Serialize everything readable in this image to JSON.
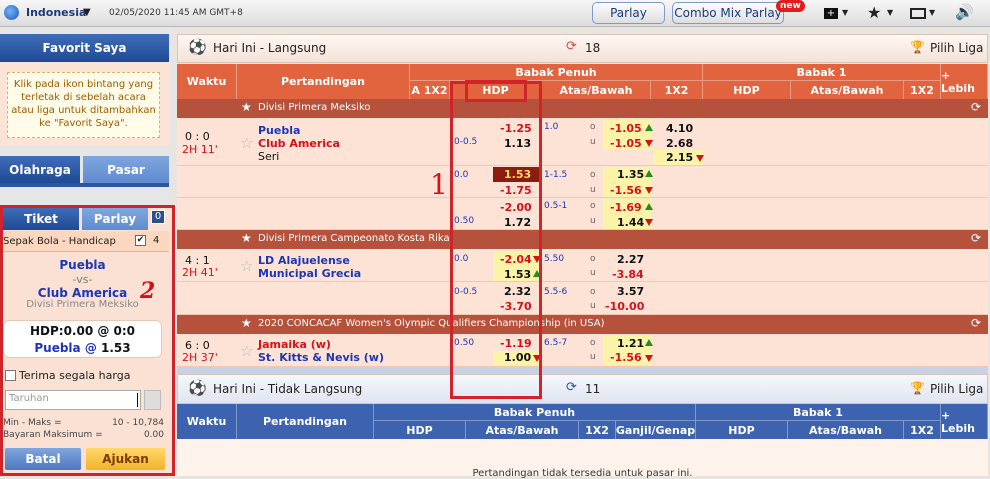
{
  "topbar": {
    "country": "Indonesia",
    "datetime": "02/05/2020 11:45 AM GMT+8",
    "parlay": "Parlay",
    "combo": "Combo Mix Parlay",
    "new_badge": "new"
  },
  "sidebar": {
    "fav_title": "Favorit Saya",
    "fav_hint": "Klik pada ikon bintang yang terletak di sebelah acara atau liga untuk ditambahkan ke \"Favorit Saya\".",
    "tab_olahraga": "Olahraga",
    "tab_pasar": "Pasar",
    "tab_tiket": "Tiket",
    "tab_parlay": "Parlay",
    "parlay_count": "0",
    "bet_type": "Sepak Bola - Handicap",
    "bet_count": "4",
    "home": "Puebla",
    "vs": "-vs-",
    "away": "Club America",
    "league": "Divisi Primera Meksiko",
    "hdp_line": "HDP:0.00 @ 0:0",
    "pick_team": "Puebla",
    "pick_at": "@",
    "pick_odds": "1.53",
    "accept_label": "Terima segala harga",
    "stake_placeholder": "Taruhan",
    "minmax_label": "Min - Maks =",
    "minmax_value": "10 - 10,784",
    "maxpay_label": "Bayaran Maksimum =",
    "maxpay_value": "0.00",
    "cancel": "Batal",
    "submit": "Ajukan",
    "annot2": "2"
  },
  "live": {
    "title": "Hari Ini - Langsung",
    "count": "18",
    "pick_league": "Pilih Liga",
    "col_waktu": "Waktu",
    "col_match": "Pertandingan",
    "babak_penuh": "Babak Penuh",
    "babak1": "Babak 1",
    "lebih": "+ Lebih",
    "a1x2": "A 1X2",
    "hdp": "HDP",
    "atasbawah": "Atas/Bawah",
    "x12": "1X2",
    "hdp2": "HDP",
    "atasbawah2": "Atas/Bawah",
    "x12b": "1X2"
  },
  "annot1": "1",
  "leagues": [
    {
      "name": "Divisi Primera Meksiko",
      "score": "0 : 0",
      "time": "2H 11'",
      "home": "Puebla",
      "away": "Club America",
      "draw": "Seri",
      "r1": {
        "hdp": "0-0.5",
        "h1": "-1.25",
        "h2": "1.13",
        "ou": "1.0",
        "o": "o",
        "u": "u",
        "ou1": "-1.05",
        "ou2": "-1.05",
        "x1": "4.10",
        "x2": "2.68",
        "x3": "2.15"
      },
      "r2": {
        "hdp": "0.0",
        "h1": "1.53",
        "h2": "-1.75",
        "ou": "1-1.5",
        "o": "o",
        "u": "u",
        "ou1": "1.35",
        "ou2": "-1.56"
      },
      "r3": {
        "hdp": "0.50",
        "h1": "-2.00",
        "h2": "1.72",
        "ou": "0.5-1",
        "o": "o",
        "u": "u",
        "ou1": "-1.69",
        "ou2": "1.44"
      }
    },
    {
      "name": "Divisi Primera Campeonato Kosta Rika",
      "score": "4 : 1",
      "time": "2H 41'",
      "home": "LD Alajuelense",
      "away": "Municipal Grecia",
      "r1": {
        "hdp": "0.0",
        "h1": "-2.04",
        "h2": "1.53",
        "ou": "5.50",
        "o": "o",
        "u": "u",
        "ou1": "2.27",
        "ou2": "-3.84"
      },
      "r2": {
        "hdp": "0-0.5",
        "h1": "2.32",
        "h2": "-3.70",
        "ou": "5.5-6",
        "o": "o",
        "u": "u",
        "ou1": "3.57",
        "ou2": "-10.00"
      }
    },
    {
      "name": "2020 CONCACAF Women's Olympic Qualifiers Championship (in USA)",
      "score": "6 : 0",
      "time": "2H 37'",
      "home": "Jamaika (w)",
      "away": "St. Kitts & Nevis (w)",
      "r1": {
        "hdp": "0.50",
        "h1": "-1.19",
        "h2": "1.00",
        "ou": "6.5-7",
        "o": "o",
        "u": "u",
        "ou1": "1.21",
        "ou2": "-1.56"
      }
    }
  ],
  "nonlive": {
    "title": "Hari Ini - Tidak Langsung",
    "count": "11",
    "pick_league": "Pilih Liga",
    "col_waktu": "Waktu",
    "col_match": "Pertandingan",
    "babak_penuh": "Babak Penuh",
    "babak1": "Babak 1",
    "lebih": "+ Lebih",
    "hdp": "HDP",
    "atasbawah": "Atas/Bawah",
    "x12": "1X2",
    "ganjil": "Ganjil/Genap",
    "hdp2": "HDP",
    "atasbawah2": "Atas/Bawah",
    "x12b": "1X2",
    "empty": "Pertandingan tidak tersedia untuk pasar ini."
  }
}
